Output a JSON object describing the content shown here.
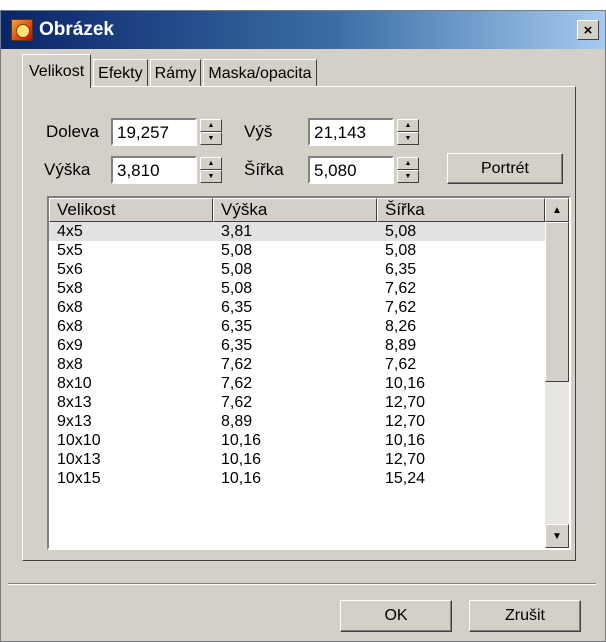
{
  "window": {
    "title": "Obrázek",
    "close_glyph": "×"
  },
  "tabs": [
    {
      "label": "Velikost",
      "active": true
    },
    {
      "label": "Efekty",
      "active": false
    },
    {
      "label": "Rámy",
      "active": false
    },
    {
      "label": "Maska/opacita",
      "active": false
    }
  ],
  "fields": {
    "left": {
      "label": "Doleva",
      "value": "19,257"
    },
    "height_pos": {
      "label": "Výš",
      "value": "21,143"
    },
    "height": {
      "label": "Výška",
      "value": "3,810"
    },
    "width": {
      "label": "Šířka",
      "value": "5,080"
    }
  },
  "buttons": {
    "portrait": "Portrét",
    "ok": "OK",
    "cancel": "Zrušit"
  },
  "table": {
    "headers": [
      "Velikost",
      "Výška",
      "Šířka"
    ],
    "rows": [
      [
        "4x5",
        "3,81",
        "5,08"
      ],
      [
        "5x5",
        "5,08",
        "5,08"
      ],
      [
        "5x6",
        "5,08",
        "6,35"
      ],
      [
        "5x8",
        "5,08",
        "7,62"
      ],
      [
        "6x8",
        "6,35",
        "7,62"
      ],
      [
        "6x8",
        "6,35",
        "8,26"
      ],
      [
        "6x9",
        "6,35",
        "8,89"
      ],
      [
        "8x8",
        "7,62",
        "7,62"
      ],
      [
        "8x10",
        "7,62",
        "10,16"
      ],
      [
        "8x13",
        "7,62",
        "12,70"
      ],
      [
        "9x13",
        "8,89",
        "12,70"
      ],
      [
        "10x10",
        "10,16",
        "10,16"
      ],
      [
        "10x13",
        "10,16",
        "12,70"
      ],
      [
        "10x15",
        "10,16",
        "15,24"
      ]
    ],
    "selected_row": 0
  },
  "icons": {
    "app": "picture-icon",
    "spin_up": "▲",
    "spin_down": "▼",
    "scroll_up": "▲",
    "scroll_down": "▼"
  }
}
